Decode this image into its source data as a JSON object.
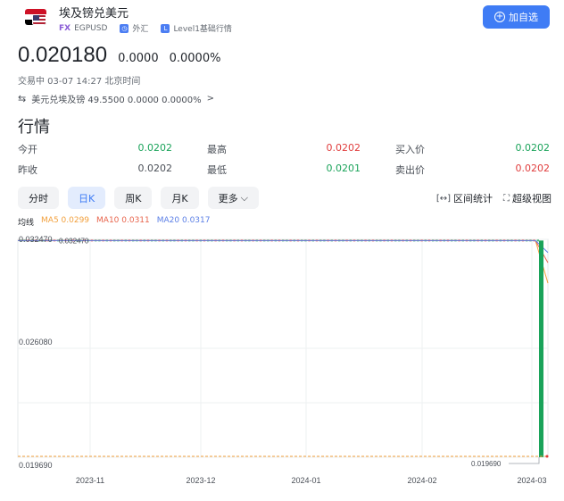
{
  "header": {
    "title": "埃及镑兑美元",
    "fx_tag": "FX",
    "code": "EGPUSD",
    "market": "外汇",
    "level": "Level1基础行情",
    "add_label": "加自选"
  },
  "quote": {
    "price": "0.020180",
    "change": "0.0000",
    "change_pct": "0.0000%",
    "status": "交易中 03-07 14:27 北京时间",
    "reverse": "美元兑埃及镑 49.5500 0.0000 0.0000%",
    "reverse_arrow": ">"
  },
  "section_title": "行情",
  "stats": {
    "open_label": "今开",
    "open": "0.0202",
    "high_label": "最高",
    "high": "0.0202",
    "bid_label": "买入价",
    "bid": "0.0202",
    "prev_label": "昨收",
    "prev": "0.0202",
    "low_label": "最低",
    "low": "0.0201",
    "ask_label": "卖出价",
    "ask": "0.0202"
  },
  "tabs": {
    "minute": "分时",
    "day": "日K",
    "week": "周K",
    "month": "月K",
    "more": "更多"
  },
  "tools": {
    "range_stats": "区间统计",
    "super_view": "超级视图"
  },
  "ma": {
    "label": "均线",
    "ma5": "MA5 0.0299",
    "ma10": "MA10 0.0311",
    "ma20": "MA20 0.0317"
  },
  "colors": {
    "accent": "#3f7cf5",
    "up": "#e03c3c",
    "down": "#1aa35a",
    "ma5": "#f2a03d",
    "ma10": "#e8644c",
    "ma20": "#5b7fe6"
  },
  "chart_data": {
    "type": "line",
    "y_ticks": [
      "0.032470",
      "0.026080",
      "0.019690"
    ],
    "ylim": [
      0.01969,
      0.03247
    ],
    "max_label": "0.032470",
    "min_label": "0.019690",
    "x_ticks": [
      "2023-11",
      "2023-12",
      "2024-01",
      "2024-02",
      "2024-03"
    ],
    "grid": true,
    "series": [
      {
        "name": "MA5",
        "values": [
          0.0324,
          0.0324,
          0.0324,
          0.0324,
          0.0299
        ]
      },
      {
        "name": "MA10",
        "values": [
          0.0324,
          0.0324,
          0.0324,
          0.0324,
          0.0311
        ]
      },
      {
        "name": "MA20",
        "values": [
          0.0324,
          0.0324,
          0.0324,
          0.0324,
          0.0317
        ]
      }
    ],
    "last_candle": {
      "open": 0.0324,
      "close": 0.0202,
      "direction": "down"
    }
  }
}
